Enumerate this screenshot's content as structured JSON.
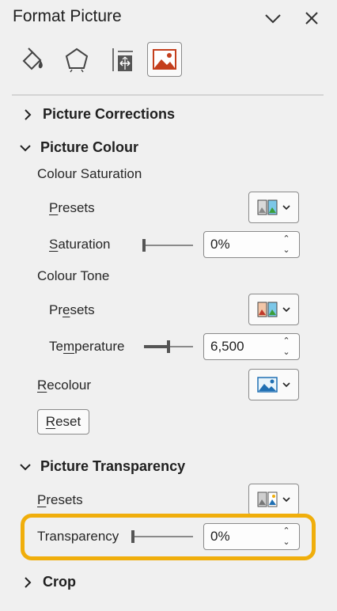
{
  "panel": {
    "title": "Format Picture"
  },
  "tabs": [
    {
      "icon": "fill-line-icon"
    },
    {
      "icon": "effects-icon"
    },
    {
      "icon": "size-properties-icon"
    },
    {
      "icon": "picture-icon",
      "active": true
    }
  ],
  "sections": {
    "picture_corrections": "Picture Corrections",
    "picture_colour": "Picture Colour",
    "picture_transparency": "Picture Transparency",
    "crop": "Crop"
  },
  "colour": {
    "saturation_heading": "Colour Saturation",
    "saturation_presets": {
      "pre": "",
      "u": "P",
      "post": "resets"
    },
    "saturation": {
      "pre": "",
      "u": "S",
      "post": "aturation",
      "value": "0%",
      "slider_level": 0
    },
    "tone_heading": "Colour Tone",
    "tone_presets": {
      "pre": "Pr",
      "u": "e",
      "post": "sets"
    },
    "temperature": {
      "pre": "Te",
      "u": "m",
      "post": "perature",
      "value": "6,500",
      "slider_level": 0.5
    },
    "recolour": {
      "pre": "",
      "u": "R",
      "post": "ecolour"
    },
    "reset": {
      "pre": "",
      "u": "R",
      "post": "eset"
    }
  },
  "transparency": {
    "presets": {
      "pre": "",
      "u": "P",
      "post": "resets"
    },
    "label": "Transparency",
    "value": "0%",
    "slider_level": 0
  },
  "colors": {
    "highlight": "#f0ae0b",
    "accent": "#c43e1c"
  }
}
